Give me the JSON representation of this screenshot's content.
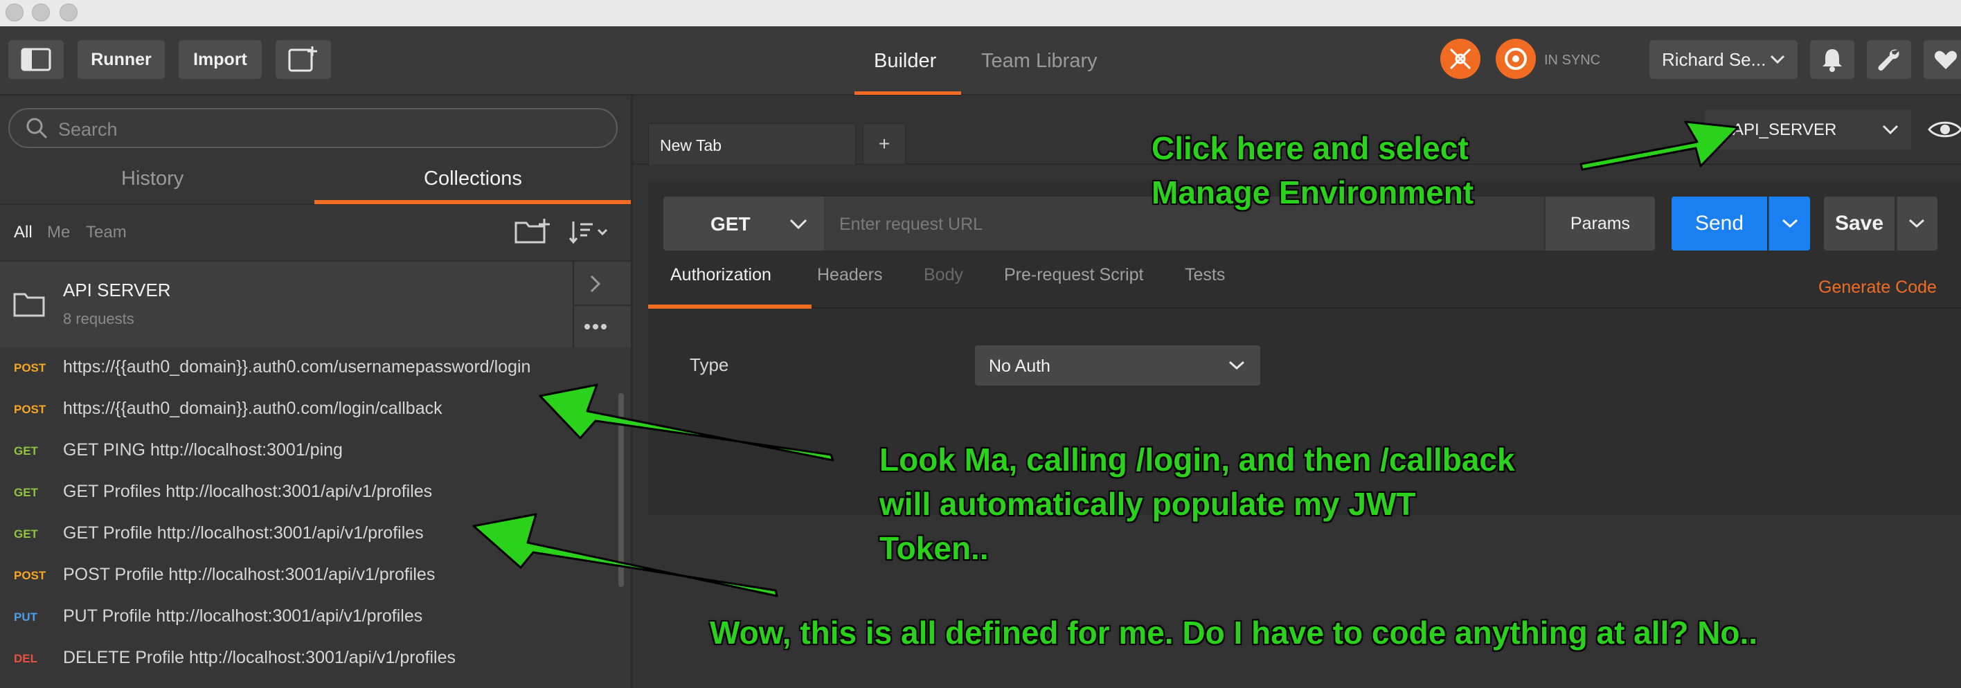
{
  "header": {
    "runner_label": "Runner",
    "import_label": "Import",
    "tabs": [
      "Builder",
      "Team Library"
    ],
    "sync_status": "IN SYNC",
    "user_name": "Richard Se..."
  },
  "sidebar": {
    "search_placeholder": "Search",
    "tabs": [
      "History",
      "Collections"
    ],
    "filters": [
      "All",
      "Me",
      "Team"
    ],
    "collection": {
      "name": "API SERVER",
      "count": "8 requests"
    },
    "requests": [
      {
        "method": "POST",
        "name": "https://{{auth0_domain}}.auth0.com/usernamepassword/login"
      },
      {
        "method": "POST",
        "name": "https://{{auth0_domain}}.auth0.com/login/callback"
      },
      {
        "method": "GET",
        "name": "GET PING http://localhost:3001/ping"
      },
      {
        "method": "GET",
        "name": "GET Profiles http://localhost:3001/api/v1/profiles"
      },
      {
        "method": "GET",
        "name": "GET Profile http://localhost:3001/api/v1/profiles"
      },
      {
        "method": "POST",
        "name": "POST Profile http://localhost:3001/api/v1/profiles"
      },
      {
        "method": "PUT",
        "name": "PUT Profile http://localhost:3001/api/v1/profiles"
      },
      {
        "method": "DEL",
        "name": "DELETE Profile http://localhost:3001/api/v1/profiles"
      }
    ]
  },
  "main": {
    "tab_label": "New Tab",
    "add_tab": "+",
    "environment": "API_SERVER",
    "method": "GET",
    "url_placeholder": "Enter request URL",
    "params_label": "Params",
    "send_label": "Send",
    "save_label": "Save",
    "request_tabs": [
      "Authorization",
      "Headers",
      "Body",
      "Pre-request Script",
      "Tests"
    ],
    "generate_code": "Generate Code",
    "auth_type_label": "Type",
    "auth_type_value": "No Auth"
  },
  "annotations": {
    "env_note_1": "Click here and select",
    "env_note_2": "Manage Environment",
    "login_note_1": "Look Ma, calling /login, and then /callback",
    "login_note_2": "will automatically populate my JWT",
    "login_note_3": "Token..",
    "defined_note": "Wow, this is all defined for me. Do I have to code anything at all? No.."
  },
  "colors": {
    "accent_orange": "#f26b22",
    "send_blue": "#1a7ff0",
    "post": "#f5a623",
    "get": "#8ec43f",
    "put": "#4a9fe8",
    "del": "#e8523f",
    "annotation_green": "#2bd21b"
  }
}
